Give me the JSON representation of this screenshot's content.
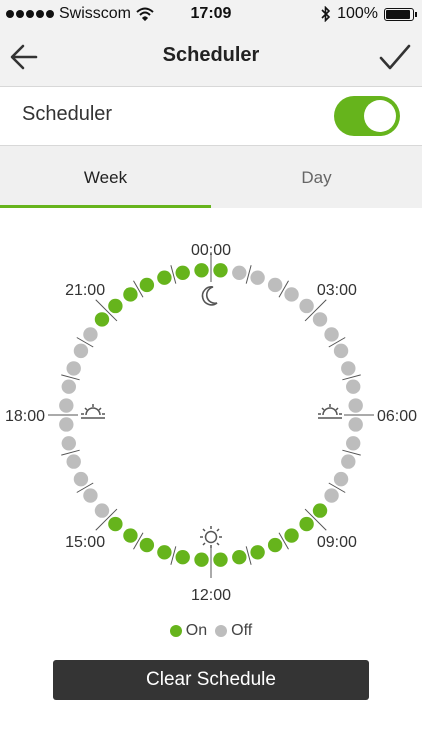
{
  "status_bar": {
    "carrier": "Swisscom",
    "time": "17:09",
    "battery": "100%",
    "battery_level": 1.0,
    "icons": [
      "signal-dots-icon",
      "wifi-icon",
      "bluetooth-icon",
      "battery-icon"
    ]
  },
  "nav": {
    "title": "Scheduler",
    "back_icon": "arrow-left-icon",
    "confirm_icon": "checkmark-icon"
  },
  "scheduler_toggle": {
    "label": "Scheduler",
    "on": true
  },
  "tabs": [
    {
      "label": "Week",
      "selected": true
    },
    {
      "label": "Day",
      "selected": false
    }
  ],
  "clock": {
    "hour_labels": [
      "00:00",
      "03:00",
      "06:00",
      "09:00",
      "12:00",
      "15:00",
      "18:00",
      "21:00"
    ],
    "slots_per_day": 48,
    "on_slots": [
      0,
      17,
      18,
      19,
      20,
      21,
      22,
      23,
      24,
      25,
      26,
      27,
      28,
      29,
      41,
      42,
      43,
      44,
      45,
      46,
      47
    ],
    "markers": [
      {
        "icon": "moon-icon",
        "hour": 0
      },
      {
        "icon": "sunrise-icon",
        "hour": 6
      },
      {
        "icon": "sun-icon",
        "hour": 12
      },
      {
        "icon": "sunset-icon",
        "hour": 18
      }
    ]
  },
  "legend": {
    "on_label": "On",
    "off_label": "Off"
  },
  "colors": {
    "on": "#66b41c",
    "off": "#bdbdbd",
    "accent": "#66b41c"
  },
  "clear_button": {
    "label": "Clear Schedule"
  }
}
